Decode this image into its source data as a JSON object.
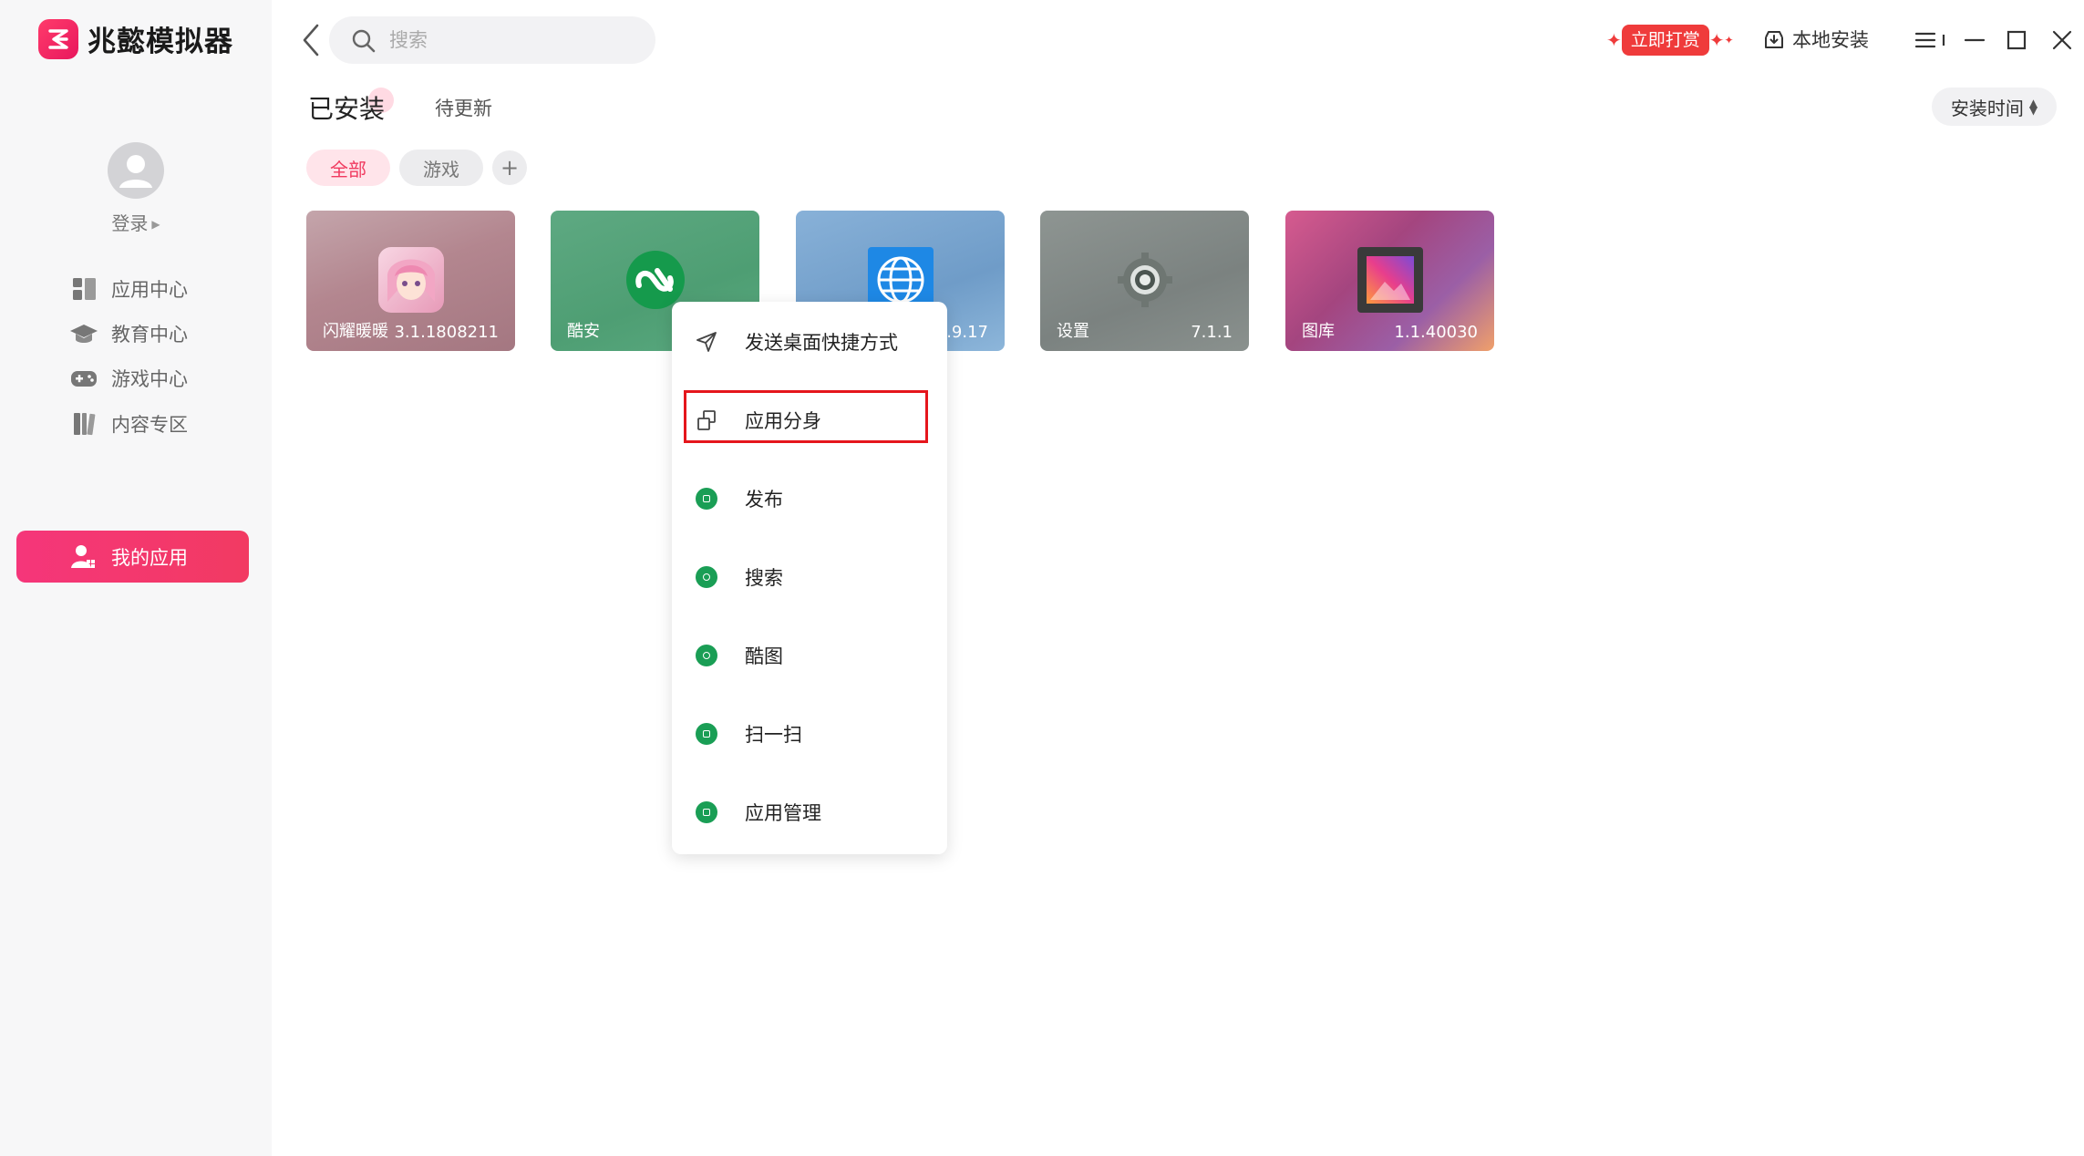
{
  "app": {
    "name": "兆懿模拟器"
  },
  "user": {
    "login_label": "登录"
  },
  "sidebar": {
    "items": [
      {
        "label": "应用中心",
        "icon": "app-center-icon"
      },
      {
        "label": "教育中心",
        "icon": "graduation-cap-icon"
      },
      {
        "label": "游戏中心",
        "icon": "gamepad-icon"
      },
      {
        "label": "内容专区",
        "icon": "books-icon"
      },
      {
        "label": "我的应用",
        "icon": "my-apps-icon",
        "active": true
      }
    ]
  },
  "search": {
    "placeholder": "搜索"
  },
  "header": {
    "reward_label": "立即打赏",
    "local_install_label": "本地安装"
  },
  "tabs": {
    "installed": "已安装",
    "updates": "待更新"
  },
  "sort": {
    "label": "安装时间"
  },
  "filters": {
    "all": "全部",
    "games": "游戏",
    "add": "+"
  },
  "apps": [
    {
      "name": "闪耀暖暖",
      "version": "3.1.1808211"
    },
    {
      "name": "酷安",
      "version": ""
    },
    {
      "name": "",
      "version": ".9.17"
    },
    {
      "name": "设置",
      "version": "7.1.1"
    },
    {
      "name": "图库",
      "version": "1.1.40030"
    }
  ],
  "context_menu": {
    "items": [
      {
        "label": "发送桌面快捷方式",
        "icon": "send-icon"
      },
      {
        "label": "应用分身",
        "icon": "clone-icon",
        "highlighted": true
      },
      {
        "label": "发布",
        "icon": "publish-icon"
      },
      {
        "label": "搜索",
        "icon": "search-icon"
      },
      {
        "label": "酷图",
        "icon": "image-icon"
      },
      {
        "label": "扫一扫",
        "icon": "scan-icon"
      },
      {
        "label": "应用管理",
        "icon": "manage-icon"
      }
    ]
  },
  "colors": {
    "accent": "#f23a66",
    "highlight": "#e5161c",
    "menu_icon_green": "#1a9e55"
  }
}
